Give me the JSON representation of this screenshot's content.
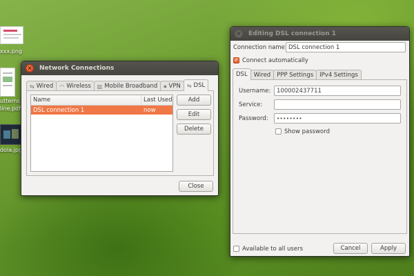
{
  "desktop": {
    "icons": [
      {
        "label": "xxx.png"
      },
      {
        "label": "utterns i"
      },
      {
        "label": "line.pdf"
      },
      {
        "label": "dola.jpg"
      }
    ]
  },
  "network_window": {
    "title": "Network Connections",
    "tabs": [
      {
        "label": "Wired",
        "icon": "network-wired-icon"
      },
      {
        "label": "Wireless",
        "icon": "wireless-icon"
      },
      {
        "label": "Mobile Broadband",
        "icon": "mobile-broadband-icon"
      },
      {
        "label": "VPN",
        "icon": "lock-icon"
      },
      {
        "label": "DSL",
        "icon": "dsl-icon"
      }
    ],
    "selected_tab": "DSL",
    "columns": [
      "Name",
      "Last Used"
    ],
    "rows": [
      {
        "name": "DSL connection 1",
        "last_used": "now"
      }
    ],
    "buttons": {
      "add": "Add",
      "edit": "Edit",
      "delete": "Delete",
      "close": "Close"
    }
  },
  "edit_window": {
    "title": "Editing DSL connection 1",
    "connection_name_label": "Connection name:",
    "connection_name_value": "DSL connection 1",
    "connect_auto_label": "Connect automatically",
    "connect_auto_checked": true,
    "tabs": [
      {
        "label": "DSL"
      },
      {
        "label": "Wired"
      },
      {
        "label": "PPP Settings"
      },
      {
        "label": "IPv4 Settings"
      }
    ],
    "selected_tab": "DSL",
    "username_label": "Username:",
    "username_value": "100002437711",
    "service_label": "Service:",
    "service_value": "",
    "password_label": "Password:",
    "password_value": "••••••••",
    "show_password_label": "Show password",
    "show_password_checked": false,
    "available_all_label": "Available to all users",
    "available_all_checked": false,
    "buttons": {
      "cancel": "Cancel",
      "apply": "Apply"
    }
  },
  "colors": {
    "selection": "#f07746",
    "titlebar": "#3c3b37",
    "window_bg": "#f2f1f0"
  }
}
